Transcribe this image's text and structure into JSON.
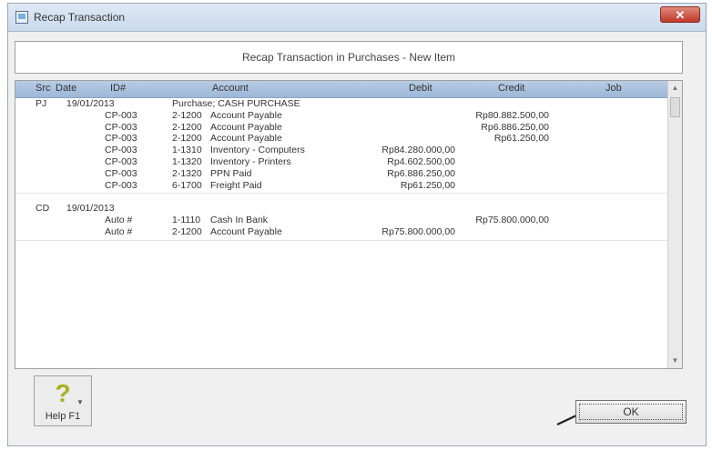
{
  "window": {
    "title": "Recap Transaction",
    "close_label": "✕"
  },
  "heading": "Recap Transaction in Purchases - New Item",
  "grid": {
    "columns": [
      "Src",
      "Date",
      "ID#",
      "Account",
      "Debit",
      "Credit",
      "Job"
    ],
    "groups": [
      {
        "src": "PJ",
        "date": "19/01/2013",
        "memo": "Purchase; CASH PURCHASE",
        "rows": [
          {
            "id": "CP-003",
            "account": "2-1200",
            "name": "Account Payable",
            "debit": "",
            "credit": "Rp80.882.500,00"
          },
          {
            "id": "CP-003",
            "account": "2-1200",
            "name": "Account Payable",
            "debit": "",
            "credit": "Rp6.886.250,00"
          },
          {
            "id": "CP-003",
            "account": "2-1200",
            "name": "Account Payable",
            "debit": "",
            "credit": "Rp61.250,00"
          },
          {
            "id": "CP-003",
            "account": "1-1310",
            "name": "Inventory - Computers",
            "debit": "Rp84.280.000,00",
            "credit": ""
          },
          {
            "id": "CP-003",
            "account": "1-1320",
            "name": "Inventory - Printers",
            "debit": "Rp4.602.500,00",
            "credit": ""
          },
          {
            "id": "CP-003",
            "account": "2-1320",
            "name": "PPN Paid",
            "debit": "Rp6.886.250,00",
            "credit": ""
          },
          {
            "id": "CP-003",
            "account": "6-1700",
            "name": "Freight Paid",
            "debit": "Rp61.250,00",
            "credit": ""
          }
        ]
      },
      {
        "src": "CD",
        "date": "19/01/2013",
        "memo": "",
        "rows": [
          {
            "id": "Auto #",
            "account": "1-1110",
            "name": "Cash In Bank",
            "debit": "",
            "credit": "Rp75.800.000,00"
          },
          {
            "id": "Auto #",
            "account": "2-1200",
            "name": "Account Payable",
            "debit": "Rp75.800.000,00",
            "credit": ""
          }
        ]
      }
    ]
  },
  "buttons": {
    "help_label": "Help F1",
    "ok_label": "OK"
  }
}
